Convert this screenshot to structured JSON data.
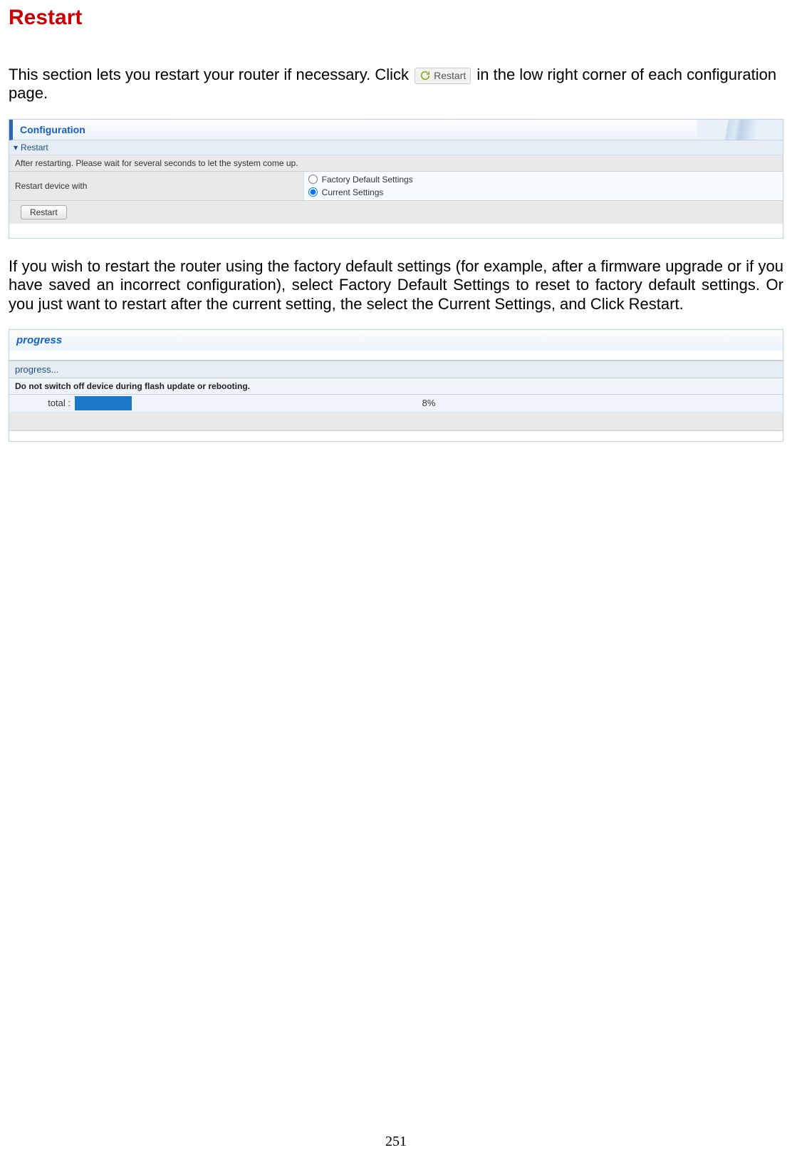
{
  "heading": "Restart",
  "intro_pre": "This section lets you restart your router if necessary. Click ",
  "inline_restart_label": "Restart",
  "intro_post": " in the low right corner of each configuration page.",
  "panel1": {
    "header": "Configuration",
    "section_label": "Restart",
    "info_text": "After restarting. Please wait for several seconds to let the system come up.",
    "option_label": "Restart device with",
    "option1": "Factory Default Settings",
    "option2": "Current Settings",
    "button_label": "Restart"
  },
  "middle_paragraph": "If you wish to restart the router using the factory default settings (for example, after a firmware upgrade or if you have saved an incorrect configuration), select Factory Default Settings to reset to factory default settings. Or you just want to restart after the current setting, the select the Current Settings, and Click Restart.",
  "panel2": {
    "header": "progress",
    "sub_header": "progress...",
    "warning": "Do not switch off device during flash update or rebooting.",
    "progress_label": "total :",
    "progress_percent": 8
  },
  "page_number": "251"
}
